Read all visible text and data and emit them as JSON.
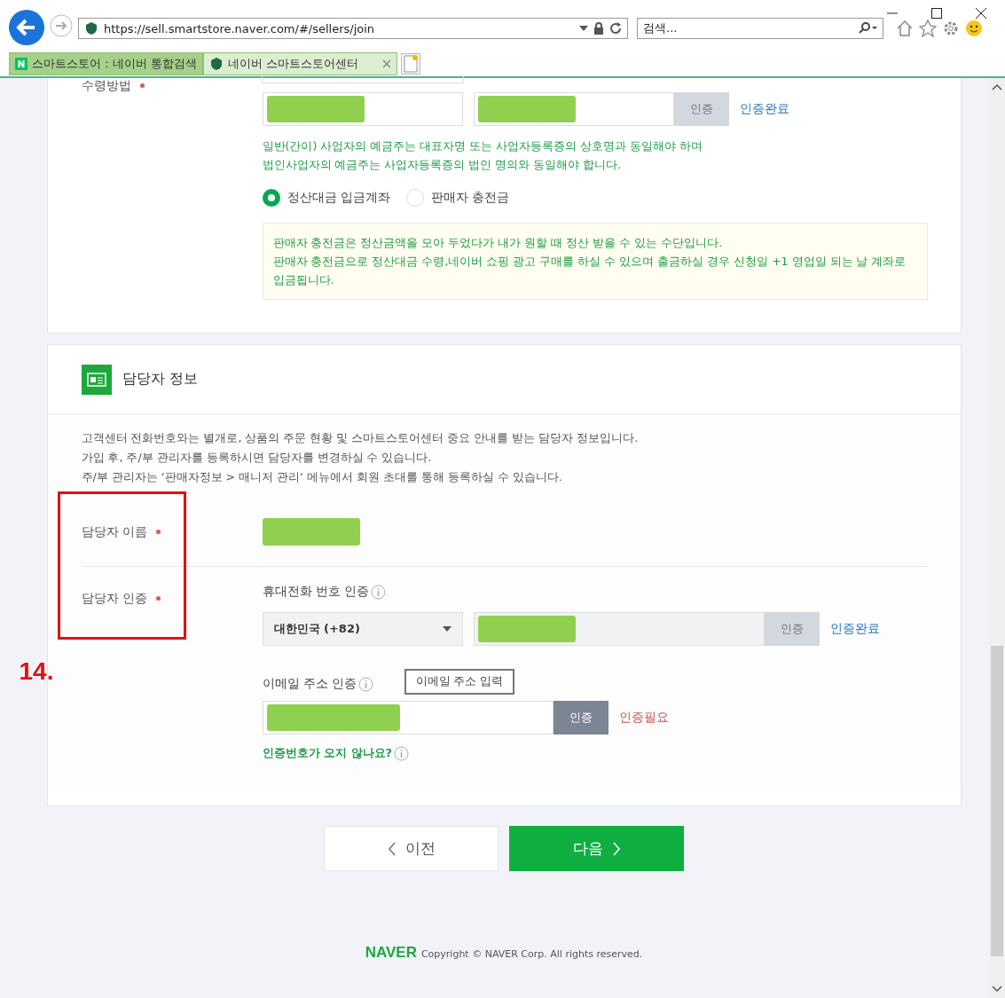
{
  "browser": {
    "address": "https://sell.smartstore.naver.com/#/sellers/join",
    "search_placeholder": "검색...",
    "tabs": [
      {
        "label": "스마트스토어 : 네이버 통합검색",
        "selected": false
      },
      {
        "label": "네이버 스마트스토어센터",
        "selected": true
      }
    ]
  },
  "payout": {
    "label": "수령방법",
    "verify_button": {
      "label": "인증",
      "disabled": true
    },
    "status": {
      "label": "인증완료",
      "verified": true
    },
    "notes": [
      "일반(간이) 사업자의 예금주는 대표자명 또는 사업자등록증의 상호명과 동일해야 하며",
      "법인사업자의 예금주는 사업자등록증의 법인 명의와 동일해야 합니다."
    ],
    "options": [
      {
        "label": "정산대금 입금계좌",
        "selected": true
      },
      {
        "label": "판매자 충전금",
        "selected": false
      }
    ],
    "info": [
      "판매자 충전금은 정산금액을 모아 두었다가 내가 원할 때 정산 받을 수 있는 수단입니다.",
      "판매자 충전금으로 정산대금 수령,네이버 쇼핑 광고 구매를 하실 수 있으며 출금하실 경우 신청일 +1 영업일 되는 날 계좌로 입금됩니다."
    ]
  },
  "contact": {
    "title": "담당자 정보",
    "description": [
      "고객센터 전화번호와는 별개로, 상품의 주문 현황 및 스마트스토어센터 중요 안내를 받는 담당자 정보입니다.",
      "가입 후, 주/부 관리자를 등록하시면 담당자를 변경하실 수 있습니다.",
      "주/부 관리자는 ‘판매자정보 > 매니저 관리‘ 메뉴에서 회원 초대를 통해 등록하실 수 있습니다."
    ],
    "name_label": "담당자 이름",
    "auth_label": "담당자 인증",
    "phone": {
      "label": "휴대전화 번호 인증",
      "country": "대한민국 (+82)",
      "verify_button": {
        "label": "인증",
        "disabled": true
      },
      "status": {
        "label": "인증완료",
        "verified": true
      }
    },
    "email": {
      "label": "이메일 주소 인증",
      "tooltip": "이메일 주소 입력",
      "verify_button": {
        "label": "인증",
        "disabled": false
      },
      "status": {
        "label": "인증필요",
        "verified": false
      }
    },
    "help_link": "인증번호가 오지 않나요?"
  },
  "buttons": {
    "prev": "이전",
    "next": "다음"
  },
  "footer": {
    "logo": "NAVER",
    "copyright": "Copyright © NAVER Corp. All rights reserved."
  },
  "annotation": {
    "label": "14."
  }
}
